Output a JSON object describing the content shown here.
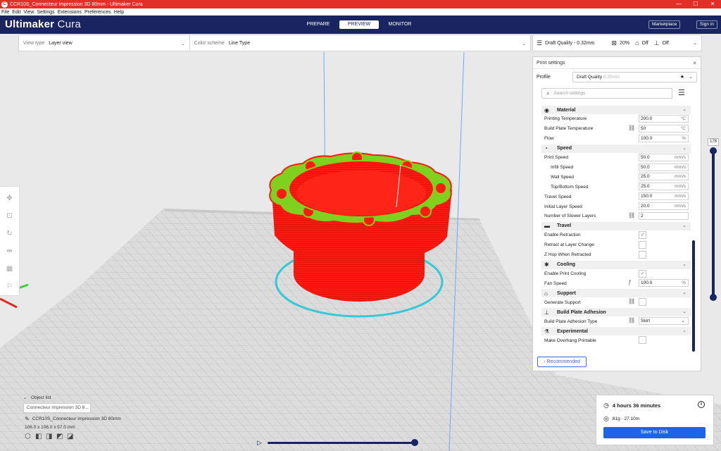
{
  "window": {
    "title": "CCR10S_Connecteur impression 3D 80mm - Ultimaker Cura",
    "app_icon": "C",
    "controls": {
      "minimize": "—",
      "maximize": "☐",
      "close": "✕"
    }
  },
  "menu": [
    "File",
    "Edit",
    "View",
    "Settings",
    "Extensions",
    "Preferences",
    "Help"
  ],
  "header": {
    "brand_bold": "Ultimaker",
    "brand_light": "Cura",
    "stages": [
      "PREPARE",
      "PREVIEW",
      "MONITOR"
    ],
    "active_stage": "PREVIEW",
    "marketplace": "Marketplace",
    "signin": "Sign in",
    "bg_color": "#192460"
  },
  "viewbar": {
    "view_type_label": "View type",
    "view_type_value": "Layer view",
    "color_scheme_label": "Color scheme",
    "color_scheme_value": "Line Type"
  },
  "settings_summary": {
    "profile": "Draft Quality - 0.32mm",
    "infill": "20%",
    "support": "Off",
    "adhesion": "Off"
  },
  "panel": {
    "title": "Print settings",
    "close": "×",
    "profile_label": "Profile",
    "profile_value": "Draft Quality",
    "profile_sub": "0.32mm",
    "search_placeholder": "Search settings",
    "recommended": "Recommended",
    "categories": [
      {
        "name": "Material",
        "icon": "thermometer-icon",
        "glyph": "◉",
        "rows": [
          {
            "label": "Printing Temperature",
            "value": "200.0",
            "unit": "°C"
          },
          {
            "label": "Build Plate Temperature",
            "value": "50",
            "unit": "°C",
            "link": true
          },
          {
            "label": "Flow",
            "value": "100.0",
            "unit": "%"
          }
        ]
      },
      {
        "name": "Speed",
        "icon": "speedometer-icon",
        "glyph": "◔",
        "rows": [
          {
            "label": "Print Speed",
            "value": "50.0",
            "unit": "mm/s"
          },
          {
            "label": "Infill Speed",
            "value": "50.0",
            "unit": "mm/s",
            "sub": true
          },
          {
            "label": "Wall Speed",
            "value": "25.0",
            "unit": "mm/s",
            "sub": true
          },
          {
            "label": "Top/Bottom Speed",
            "value": "25.0",
            "unit": "mm/s",
            "sub": true
          },
          {
            "label": "Travel Speed",
            "value": "150.0",
            "unit": "mm/s"
          },
          {
            "label": "Initial Layer Speed",
            "value": "20.0",
            "unit": "mm/s"
          },
          {
            "label": "Number of Slower Layers",
            "value": "2",
            "unit": "",
            "link": true
          }
        ]
      },
      {
        "name": "Travel",
        "icon": "travel-icon",
        "glyph": "▬",
        "rows": [
          {
            "label": "Enable Retraction",
            "check": "✓"
          },
          {
            "label": "Retract at Layer Change",
            "check": ""
          },
          {
            "label": "Z Hop When Retracted",
            "check": ""
          }
        ]
      },
      {
        "name": "Cooling",
        "icon": "fan-icon",
        "glyph": "✱",
        "rows": [
          {
            "label": "Enable Print Cooling",
            "check": "✓"
          },
          {
            "label": "Fan Speed",
            "value": "100.0",
            "unit": "%",
            "fx": true
          }
        ]
      },
      {
        "name": "Support",
        "icon": "support-icon",
        "glyph": "⌂",
        "rows": [
          {
            "label": "Generate Support",
            "check": "",
            "link": true
          }
        ]
      },
      {
        "name": "Build Plate Adhesion",
        "icon": "adhesion-icon",
        "glyph": "⊥",
        "rows": [
          {
            "label": "Build Plate Adhesion Type",
            "value": "Skirt",
            "select": true,
            "link": true
          }
        ]
      },
      {
        "name": "Experimental",
        "icon": "flask-icon",
        "glyph": "⚗",
        "rows": [
          {
            "label": "Make Overhang Printable",
            "check": ""
          }
        ]
      }
    ]
  },
  "layer_slider": {
    "value": "178",
    "upper_fraction": 1.0,
    "lower_fraction": 0.0
  },
  "object_list": {
    "header": "Object list",
    "selected": "Connecteur impression 3D 8...",
    "file_name": "CCR10S_Connecteur impression 3D 80mm",
    "dimensions": "106.0 x 106.0 x 57.0 mm"
  },
  "job": {
    "time": "4 hours 36 minutes",
    "material": "81g · 27.10m",
    "save": "Save to Disk"
  },
  "colors": {
    "title_red": "#e22f28",
    "accent_blue": "#1f63e8",
    "model_red": "#ff1a12",
    "model_green": "#7fd11f",
    "skirt_cyan": "#33c9d6"
  }
}
